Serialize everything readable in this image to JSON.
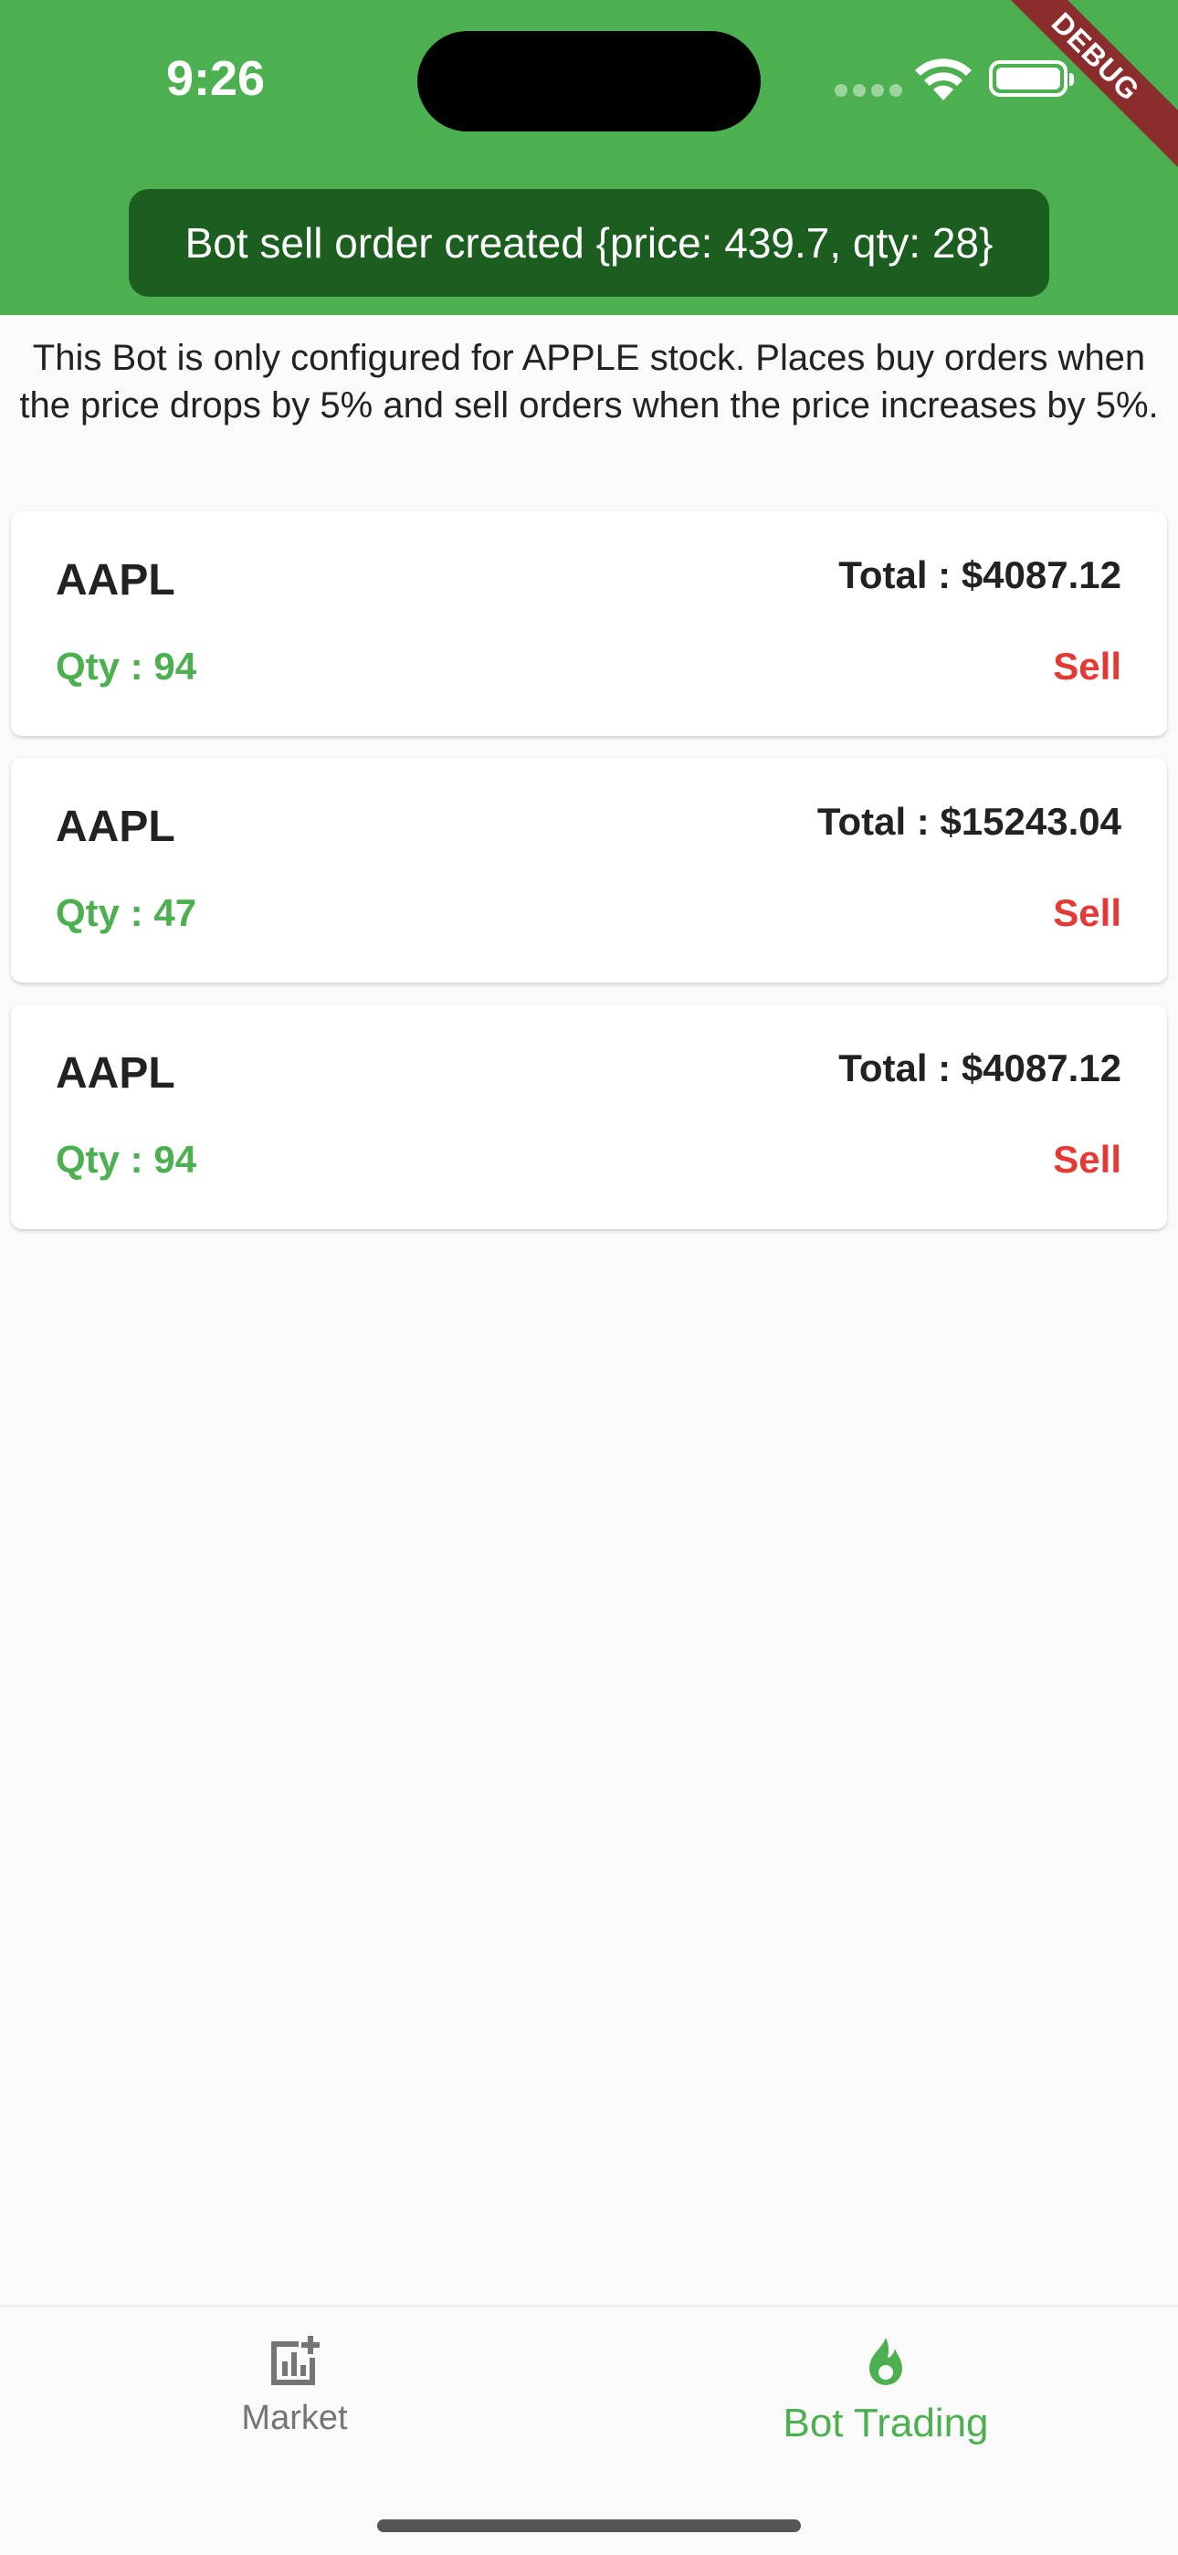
{
  "status_bar": {
    "time": "9:26"
  },
  "debug_banner": "DEBUG",
  "toast": {
    "message": "Bot sell order created {price: 439.7, qty: 28}"
  },
  "description": "This Bot is only configured for APPLE stock. Places buy orders when the price drops by 5% and sell orders when the price increases by 5%.",
  "orders": [
    {
      "symbol": "AAPL",
      "total": "Total : $4087.12",
      "qty": "Qty : 94",
      "action": "Sell"
    },
    {
      "symbol": "AAPL",
      "total": "Total : $15243.04",
      "qty": "Qty : 47",
      "action": "Sell"
    },
    {
      "symbol": "AAPL",
      "total": "Total : $4087.12",
      "qty": "Qty : 94",
      "action": "Sell"
    }
  ],
  "bottom_nav": {
    "items": [
      {
        "label": "Market",
        "icon": "chart-add-icon",
        "active": false
      },
      {
        "label": "Bot Trading",
        "icon": "flame-icon",
        "active": true
      }
    ]
  },
  "colors": {
    "primary": "#4caf50",
    "toast_bg": "#1b5e20",
    "sell": "#e53935",
    "debug": "#8b2d2d"
  }
}
